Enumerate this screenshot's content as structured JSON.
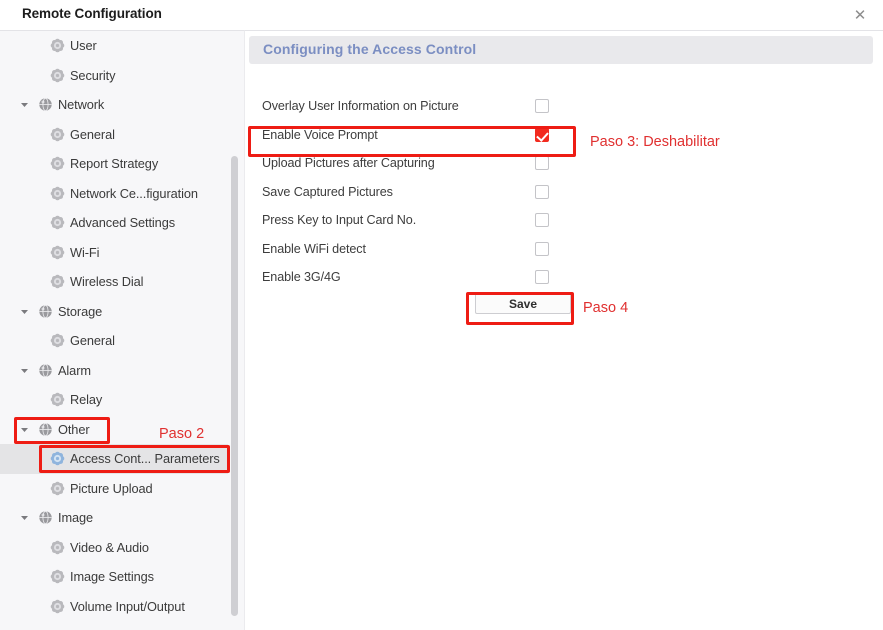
{
  "window": {
    "title": "Remote Configuration",
    "close_label": "✕"
  },
  "sidebar": {
    "items": [
      {
        "label": "User",
        "level": 2,
        "icon": "flower-gear-icon",
        "expandable": false,
        "selected": false
      },
      {
        "label": "Security",
        "level": 2,
        "icon": "flower-gear-icon",
        "expandable": false,
        "selected": false
      },
      {
        "label": "Network",
        "level": 1,
        "icon": "globe-icon",
        "expandable": true,
        "selected": false
      },
      {
        "label": "General",
        "level": 2,
        "icon": "flower-gear-icon",
        "expandable": false,
        "selected": false
      },
      {
        "label": "Report Strategy",
        "level": 2,
        "icon": "flower-gear-icon",
        "expandable": false,
        "selected": false
      },
      {
        "label": "Network Ce...figuration",
        "level": 2,
        "icon": "flower-gear-icon",
        "expandable": false,
        "selected": false
      },
      {
        "label": "Advanced Settings",
        "level": 2,
        "icon": "flower-gear-icon",
        "expandable": false,
        "selected": false
      },
      {
        "label": "Wi-Fi",
        "level": 2,
        "icon": "flower-gear-icon",
        "expandable": false,
        "selected": false
      },
      {
        "label": "Wireless Dial",
        "level": 2,
        "icon": "flower-gear-icon",
        "expandable": false,
        "selected": false
      },
      {
        "label": "Storage",
        "level": 1,
        "icon": "globe-icon",
        "expandable": true,
        "selected": false
      },
      {
        "label": "General",
        "level": 2,
        "icon": "flower-gear-icon",
        "expandable": false,
        "selected": false
      },
      {
        "label": "Alarm",
        "level": 1,
        "icon": "globe-icon",
        "expandable": true,
        "selected": false
      },
      {
        "label": "Relay",
        "level": 2,
        "icon": "flower-gear-icon",
        "expandable": false,
        "selected": false
      },
      {
        "label": "Other",
        "level": 1,
        "icon": "globe-icon",
        "expandable": true,
        "selected": false
      },
      {
        "label": "Access Cont... Parameters",
        "level": 2,
        "icon": "flower-gear-icon-active",
        "expandable": false,
        "selected": true
      },
      {
        "label": "Picture Upload",
        "level": 2,
        "icon": "flower-gear-icon",
        "expandable": false,
        "selected": false
      },
      {
        "label": "Image",
        "level": 1,
        "icon": "globe-icon",
        "expandable": true,
        "selected": false
      },
      {
        "label": "Video & Audio",
        "level": 2,
        "icon": "flower-gear-icon",
        "expandable": false,
        "selected": false
      },
      {
        "label": "Image Settings",
        "level": 2,
        "icon": "flower-gear-icon",
        "expandable": false,
        "selected": false
      },
      {
        "label": "Volume Input/Output",
        "level": 2,
        "icon": "flower-gear-icon",
        "expandable": false,
        "selected": false
      }
    ]
  },
  "panel": {
    "header_title": "Configuring the Access Control",
    "header_color": "#7b8ec2",
    "rows": [
      {
        "label": "Overlay User Information on Picture",
        "checked": false
      },
      {
        "label": "Enable Voice Prompt",
        "checked": true
      },
      {
        "label": "Upload Pictures after Capturing",
        "checked": false
      },
      {
        "label": "Save Captured Pictures",
        "checked": false
      },
      {
        "label": "Press Key to Input Card No.",
        "checked": false
      },
      {
        "label": "Enable WiFi detect",
        "checked": false
      },
      {
        "label": "Enable 3G/4G",
        "checked": false
      }
    ],
    "save_label": "Save"
  },
  "annotations": {
    "accent_color": "#ee1c14",
    "text_color": "#e03030",
    "step2": "Paso 2",
    "step3": "Paso 3: Deshabilitar",
    "step4": "Paso 4"
  }
}
